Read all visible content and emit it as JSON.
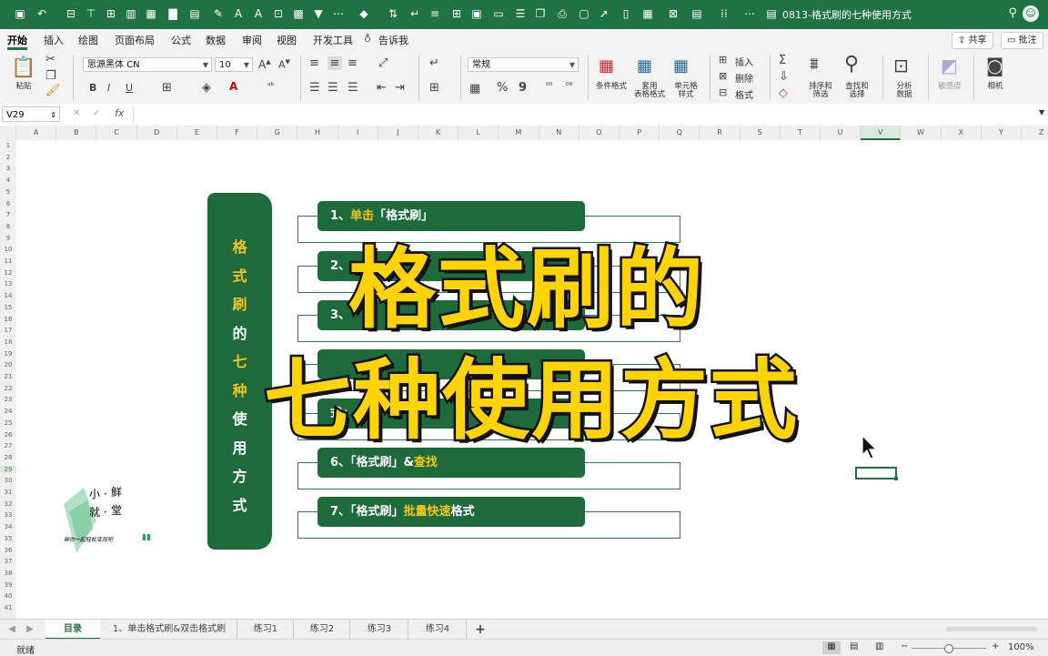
{
  "app": {
    "doc_title": "0813-格式刷的七种使用方式",
    "accent": "#207245"
  },
  "ribbon_tabs": [
    {
      "label": "开始",
      "active": true
    },
    {
      "label": "插入"
    },
    {
      "label": "绘图"
    },
    {
      "label": "页面布局"
    },
    {
      "label": "公式"
    },
    {
      "label": "数据"
    },
    {
      "label": "审阅"
    },
    {
      "label": "视图"
    },
    {
      "label": "开发工具"
    },
    {
      "label": "告诉我"
    }
  ],
  "share_label": "共享",
  "comment_label": "批注",
  "ribbon": {
    "paste": "粘贴",
    "font_name": "思源黑体 CN",
    "font_size": "10",
    "number_format": "常规",
    "conditional_format": "条件格式",
    "table_format_1": "套用",
    "table_format_2": "表格格式",
    "cell_style_1": "单元格",
    "cell_style_2": "样式",
    "insert": "插入",
    "delete": "删除",
    "format": "格式",
    "sort_1": "排序和",
    "sort_2": "筛选",
    "find_1": "查找和",
    "find_2": "选择",
    "analyze_1": "分析",
    "analyze_2": "数据",
    "sensitivity": "敏感度",
    "camera": "相机",
    "bold": "B",
    "italic": "I",
    "underline": "U",
    "percent": "%",
    "comma": "9"
  },
  "formula_bar": {
    "cell_ref": "V29",
    "fx": "fx",
    "cancel": "✕",
    "confirm": "✓"
  },
  "columns": [
    "A",
    "B",
    "C",
    "D",
    "E",
    "F",
    "G",
    "H",
    "I",
    "J",
    "K",
    "L",
    "M",
    "N",
    "O",
    "P",
    "Q",
    "R",
    "S",
    "T",
    "U",
    "V",
    "W",
    "X",
    "Y",
    "Z"
  ],
  "rows": [
    "1",
    "2",
    "3",
    "4",
    "5",
    "6",
    "7",
    "8",
    "9",
    "10",
    "11",
    "12",
    "13",
    "14",
    "15",
    "16",
    "17",
    "18",
    "19",
    "20",
    "21",
    "22",
    "23",
    "24",
    "25",
    "26",
    "27",
    "28",
    "29",
    "30",
    "31",
    "32",
    "33",
    "34",
    "35",
    "36",
    "37",
    "38",
    "39",
    "40",
    "41"
  ],
  "vertical_title": [
    {
      "ch": "格",
      "color": "#f5c518"
    },
    {
      "ch": "式",
      "color": "#f5c518"
    },
    {
      "ch": "刷",
      "color": "#f5c518"
    },
    {
      "ch": "的",
      "color": "#ffffff"
    },
    {
      "ch": "七",
      "color": "#f5c518"
    },
    {
      "ch": "种",
      "color": "#f5c518"
    },
    {
      "ch": "使",
      "color": "#ffffff"
    },
    {
      "ch": "用",
      "color": "#ffffff"
    },
    {
      "ch": "方",
      "color": "#ffffff"
    },
    {
      "ch": "式",
      "color": "#ffffff"
    }
  ],
  "items": [
    {
      "parts": [
        {
          "t": "1、",
          "y": false
        },
        {
          "t": "单击",
          "y": true
        },
        {
          "t": "「格式刷」",
          "y": false
        }
      ]
    },
    {
      "parts": [
        {
          "t": "2、",
          "y": false
        }
      ]
    },
    {
      "parts": [
        {
          "t": "3、",
          "y": false
        }
      ]
    },
    {
      "parts": [
        {
          "t": "",
          "y": false
        }
      ]
    },
    {
      "parts": [
        {
          "t": "式",
          "y": false
        },
        {
          "t": "」",
          "y": false
        },
        {
          "t": "&",
          "y": false
        },
        {
          "t": "复",
          "y": true
        }
      ]
    },
    {
      "parts": [
        {
          "t": "6、「格式刷」&",
          "y": false
        },
        {
          "t": "查找",
          "y": true
        }
      ]
    },
    {
      "parts": [
        {
          "t": "7、「格式刷」",
          "y": false
        },
        {
          "t": "批量快速",
          "y": true
        },
        {
          "t": "格式",
          "y": false
        }
      ]
    }
  ],
  "overlay": {
    "line1": "格式刷的",
    "line2": "七种使用方式"
  },
  "logo": {
    "line1": "小 ·",
    "line2": "鲜",
    "line3": "就 ·",
    "line4": "堂",
    "tagline": "帮你一起轻松变现吧"
  },
  "sheet_tabs": [
    {
      "label": "目录",
      "active": true
    },
    {
      "label": "1、单击格式刷&双击格式刷"
    },
    {
      "label": "练习1"
    },
    {
      "label": "练习2"
    },
    {
      "label": "练习3"
    },
    {
      "label": "练习4"
    }
  ],
  "add_sheet": "+",
  "status": {
    "ready": "就绪",
    "zoom": "100%"
  }
}
